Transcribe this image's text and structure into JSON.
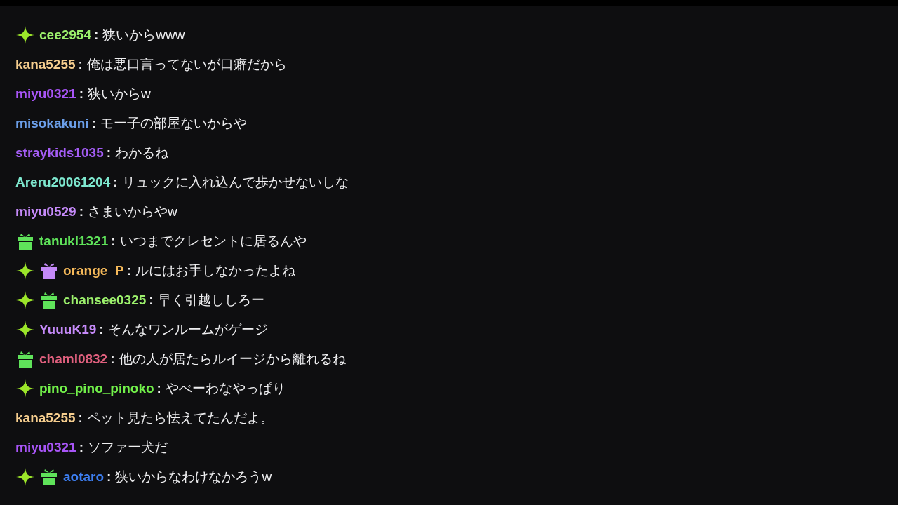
{
  "separator": ":",
  "messages": [
    {
      "user": "cee2954",
      "color": "#9cf06c",
      "text": "狭いからwww",
      "badges": [
        {
          "kind": "sparkle",
          "color": "#9ce62a"
        }
      ]
    },
    {
      "user": "kana5255",
      "color": "#f5cd8e",
      "text": "俺は悪口言ってないが口癖だから"
    },
    {
      "user": "miyu0321",
      "color": "#a855f7",
      "text": "狭いからw"
    },
    {
      "user": "misokakuni",
      "color": "#6b9ee8",
      "text": "モー子の部屋ないからや"
    },
    {
      "user": "straykids1035",
      "color": "#a45df5",
      "text": "わかるね"
    },
    {
      "user": "Areru20061204",
      "color": "#7ee8cf",
      "text": "リュックに入れ込んで歩かせないしな"
    },
    {
      "user": "miyu0529",
      "color": "#c58af9",
      "text": "さまいからやw"
    },
    {
      "user": "tanuki1321",
      "color": "#5fe35a",
      "text": "いつまでクレセントに居るんや",
      "badges": [
        {
          "kind": "gift",
          "color": "#5fe35a"
        }
      ]
    },
    {
      "user": "orange_P",
      "color": "#f5b95a",
      "text": "ルにはお手しなかったよね",
      "badges": [
        {
          "kind": "sparkle",
          "color": "#9ce62a"
        },
        {
          "kind": "gift",
          "color": "#c58af9"
        }
      ]
    },
    {
      "user": "chansee0325",
      "color": "#9cf06c",
      "text": "早く引越ししろー",
      "badges": [
        {
          "kind": "sparkle",
          "color": "#9ce62a"
        },
        {
          "kind": "gift",
          "color": "#5fe35a"
        }
      ]
    },
    {
      "user": "YuuuK19",
      "color": "#c58af9",
      "text": "そんなワンルームがゲージ",
      "badges": [
        {
          "kind": "sparkle",
          "color": "#9ce62a"
        }
      ]
    },
    {
      "user": "chami0832",
      "color": "#e0607e",
      "text": "他の人が居たらルイージから離れるね",
      "badges": [
        {
          "kind": "gift",
          "color": "#5fe35a"
        }
      ]
    },
    {
      "user": "pino_pino_pinoko",
      "color": "#72f04a",
      "text": "やべーわなやっぱり",
      "badges": [
        {
          "kind": "sparkle",
          "color": "#9ce62a"
        }
      ]
    },
    {
      "user": "kana5255",
      "color": "#f5cd8e",
      "text": "ペット見たら怯えてたんだよ。"
    },
    {
      "user": "miyu0321",
      "color": "#a855f7",
      "text": "ソファー犬だ"
    },
    {
      "user": "aotaro",
      "color": "#3d7ef0",
      "text": "狭いからなわけなかろうw",
      "badges": [
        {
          "kind": "sparkle",
          "color": "#9ce62a"
        },
        {
          "kind": "gift",
          "color": "#5fe35a"
        }
      ]
    }
  ]
}
